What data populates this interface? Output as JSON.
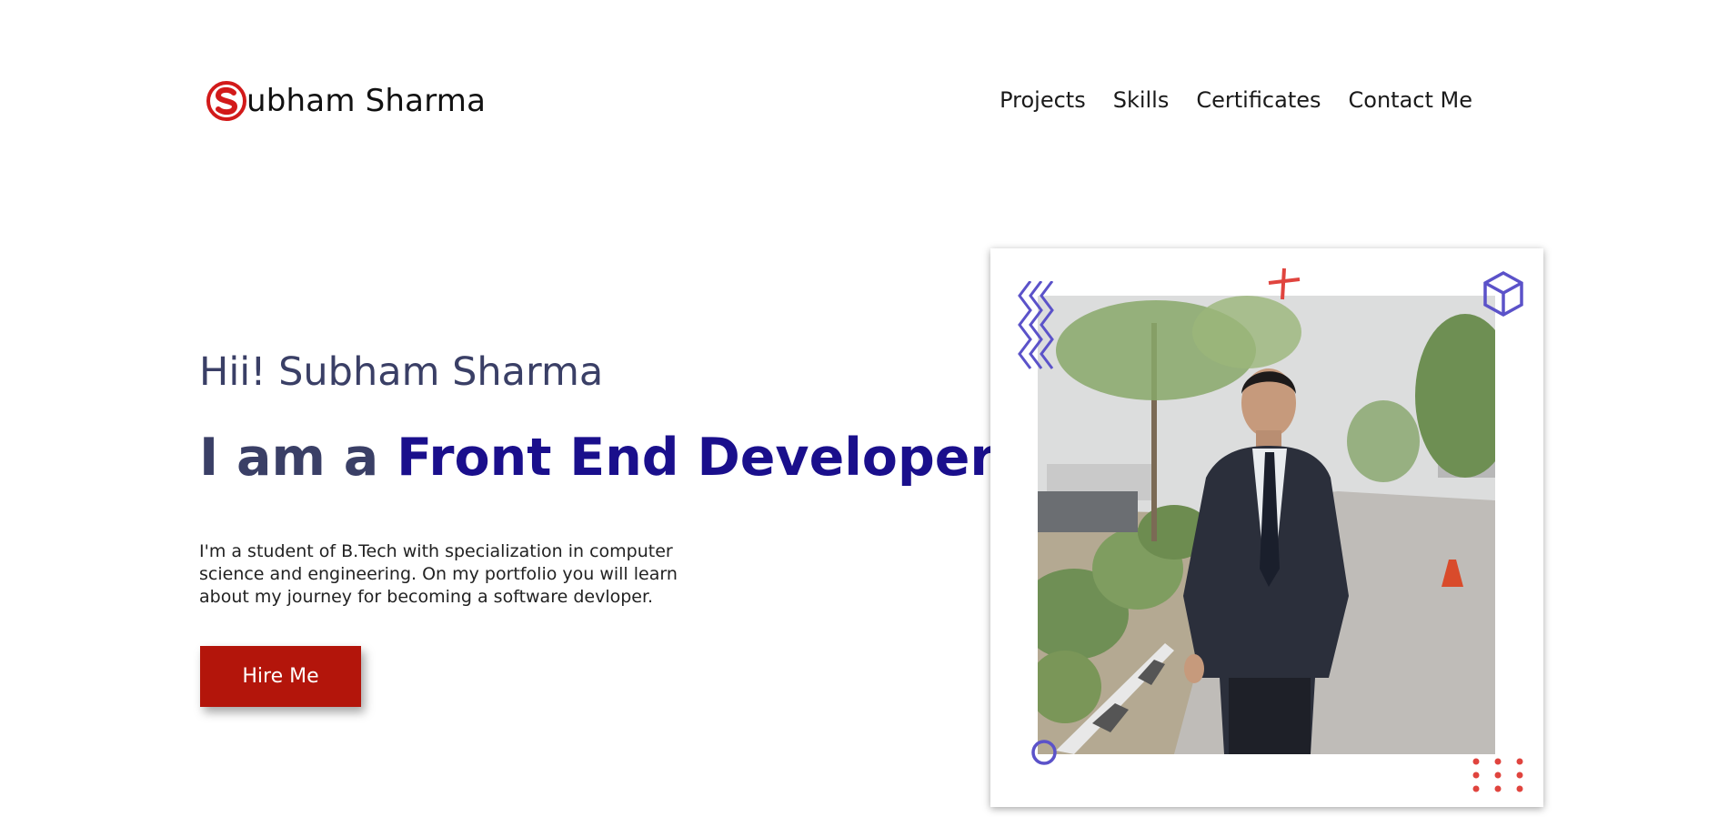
{
  "header": {
    "logo_text": "ubham Sharma",
    "logo_icon": "s-logo-icon"
  },
  "nav": {
    "items": [
      "Projects",
      "Skills",
      "Certificates",
      "Contact Me"
    ]
  },
  "hero": {
    "greeting": "Hii! Subham Sharma",
    "headline_prefix": "I am a ",
    "headline_role": "Front End Developer",
    "description": "I'm a student of B.Tech with specialization in computer science and engineering. On my portfolio you will learn about my journey for becoming a software devloper.",
    "cta_label": "Hire Me"
  },
  "photo_card": {
    "image": "profile-photo",
    "decorations": [
      "zigzag-icon",
      "cross-icon",
      "cube-icon",
      "circle-icon",
      "dots-grid-icon"
    ]
  },
  "colors": {
    "accent_red": "#b3150b",
    "headline_blue": "#1a0f8c",
    "text_slate": "#3a3f66",
    "deco_purple": "#5b52c9",
    "deco_red": "#e0443e"
  }
}
